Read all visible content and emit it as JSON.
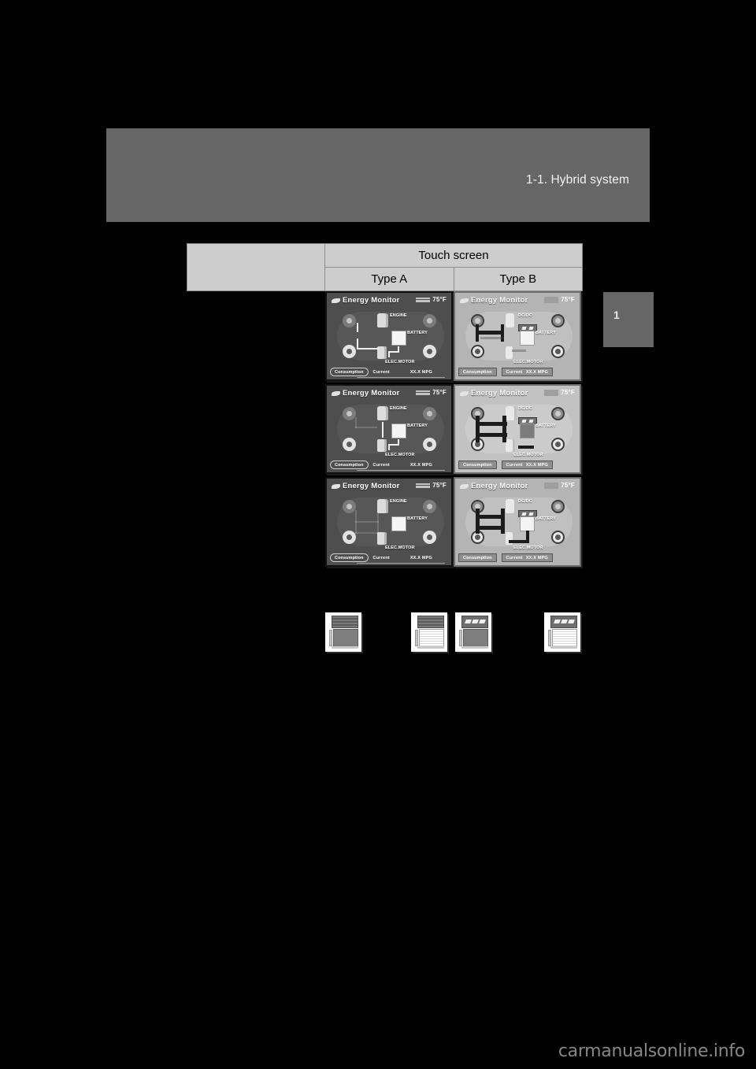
{
  "page": {
    "background_color": "#000000",
    "header_band_color": "#666666",
    "header_title": "1-1. Hybrid system",
    "chapter_tab_number": "1",
    "watermark": "carmanualsonline.info"
  },
  "table": {
    "header": {
      "blank_cell": "",
      "group_label": "Touch screen",
      "columns": [
        "Type A",
        "Type B"
      ]
    },
    "rows": [
      {
        "label": "",
        "type_a": {
          "title": "Energy Monitor",
          "temperature": "75°F",
          "engine_label": "ENGINE",
          "battery_label": "BATTERY",
          "motor_label": "ELEC.MOTOR",
          "consumption_button": "Consumption",
          "current_label": "Current",
          "mpg_value": "XX.X MPG"
        },
        "type_b": {
          "title": "Energy Monitor",
          "temperature": "75°F",
          "engine_label": "DC/DC",
          "battery_label": "BATTERY",
          "motor_label": "ELEC.MOTOR",
          "consumption_button": "Consumption",
          "current_label": "Current",
          "mpg_value": "XX.X MPG"
        }
      },
      {
        "label": "",
        "type_a": {
          "title": "Energy Monitor",
          "temperature": "75°F",
          "engine_label": "ENGINE",
          "battery_label": "BATTERY",
          "motor_label": "ELEC.MOTOR",
          "consumption_button": "Consumption",
          "current_label": "Current",
          "mpg_value": "XX.X MPG"
        },
        "type_b": {
          "title": "Energy Monitor",
          "temperature": "75°F",
          "engine_label": "DC/DC",
          "battery_label": "BATTERY",
          "motor_label": "ELEC.MOTOR",
          "consumption_button": "Consumption",
          "current_label": "Current",
          "mpg_value": "XX.X MPG"
        }
      },
      {
        "label": "",
        "type_a": {
          "title": "Energy Monitor",
          "temperature": "75°F",
          "engine_label": "ENGINE",
          "battery_label": "BATTERY",
          "motor_label": "ELEC.MOTOR",
          "consumption_button": "Consumption",
          "current_label": "Current",
          "mpg_value": "XX.X MPG"
        },
        "type_b": {
          "title": "Energy Monitor",
          "temperature": "75°F",
          "engine_label": "DC/DC",
          "battery_label": "BATTERY",
          "motor_label": "ELEC.MOTOR",
          "consumption_button": "Consumption",
          "current_label": "Current",
          "mpg_value": "XX.X MPG"
        }
      }
    ]
  },
  "thumbnails": [
    {
      "name": "thumb-1",
      "cap_style": "hatch",
      "body_style": "solid"
    },
    {
      "name": "thumb-2",
      "cap_style": "hatch",
      "body_style": "lined"
    },
    {
      "name": "thumb-3",
      "cap_style": "blades",
      "body_style": "solid"
    },
    {
      "name": "thumb-4",
      "cap_style": "blades",
      "body_style": "lined"
    }
  ]
}
